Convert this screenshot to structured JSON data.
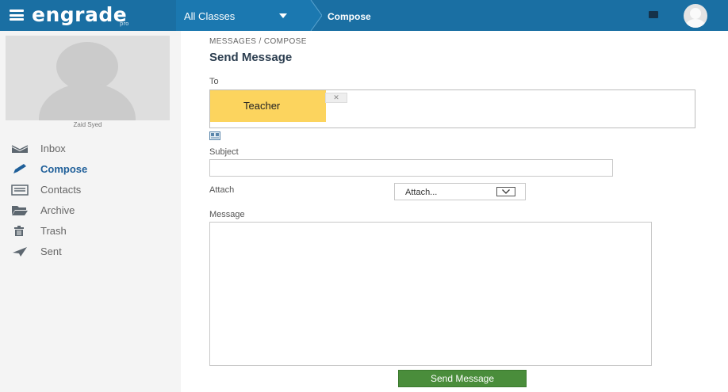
{
  "app": {
    "logo": "engrade",
    "logo_sub": "pro"
  },
  "topbar": {
    "class_selector": "All Classes",
    "current_page": "Compose"
  },
  "sidebar": {
    "profile_name": "Zaid Syed",
    "items": [
      {
        "label": "Inbox",
        "icon": "inbox-icon",
        "active": false
      },
      {
        "label": "Compose",
        "icon": "pencil-icon",
        "active": true
      },
      {
        "label": "Contacts",
        "icon": "contacts-card-icon",
        "active": false
      },
      {
        "label": "Archive",
        "icon": "folder-icon",
        "active": false
      },
      {
        "label": "Trash",
        "icon": "trash-icon",
        "active": false
      },
      {
        "label": "Sent",
        "icon": "paper-plane-icon",
        "active": false
      }
    ]
  },
  "main": {
    "breadcrumb": "MESSAGES / COMPOSE",
    "title": "Send Message",
    "to_label": "To",
    "recipient": "Teacher",
    "remove_recipient": "✕",
    "subject_label": "Subject",
    "subject_value": "",
    "attach_label": "Attach",
    "attach_selected": "Attach...",
    "message_label": "Message",
    "message_value": "",
    "send_button": "Send Message"
  },
  "colors": {
    "topbar": "#1a6fa3",
    "active_nav": "#1f5f99",
    "send_button": "#4a8d3b",
    "recipient_highlight": "#fcd45e"
  }
}
